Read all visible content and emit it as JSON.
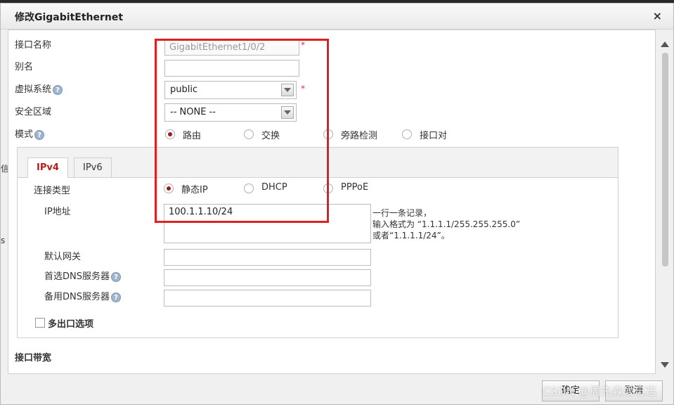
{
  "dialog": {
    "title": "修改GigabitEthernet",
    "close_label": "×"
  },
  "form": {
    "interface_name_label": "接口名称",
    "interface_name_value": "GigabitEthernet1/0/2",
    "alias_label": "别名",
    "alias_value": "",
    "vsys_label": "虚拟系统",
    "vsys_value": "public",
    "zone_label": "安全区域",
    "zone_value": "-- NONE --",
    "mode_label": "模式",
    "required_mark": "*",
    "help_mark": "?",
    "mode_options": [
      "路由",
      "交换",
      "旁路检测",
      "接口对"
    ],
    "mode_selected": "路由"
  },
  "tabs": [
    "IPv4",
    "IPv6"
  ],
  "ipv4": {
    "conn_type_label": "连接类型",
    "conn_types": [
      "静态IP",
      "DHCP",
      "PPPoE"
    ],
    "conn_selected": "静态IP",
    "ip_label": "IP地址",
    "ip_value": "100.1.1.10/24",
    "ip_hint_1": "一行一条记录，",
    "ip_hint_2": "输入格式为 “1.1.1.1/255.255.255.0”",
    "ip_hint_3": "或者“1.1.1.1/24”。",
    "gateway_label": "默认网关",
    "dns1_label": "首选DNS服务器",
    "dns2_label": "备用DNS服务器",
    "multi_exit_label": "多出口选项"
  },
  "bandwidth_label": "接口带宽",
  "buttons": {
    "ok": "确定",
    "cancel": "取消"
  },
  "watermark": "CSDN @周先森爱忘忘",
  "left_edge": [
    "信",
    "s"
  ],
  "colors": {
    "accent_red": "#b71c1c",
    "annotation_red": "#e02020"
  }
}
